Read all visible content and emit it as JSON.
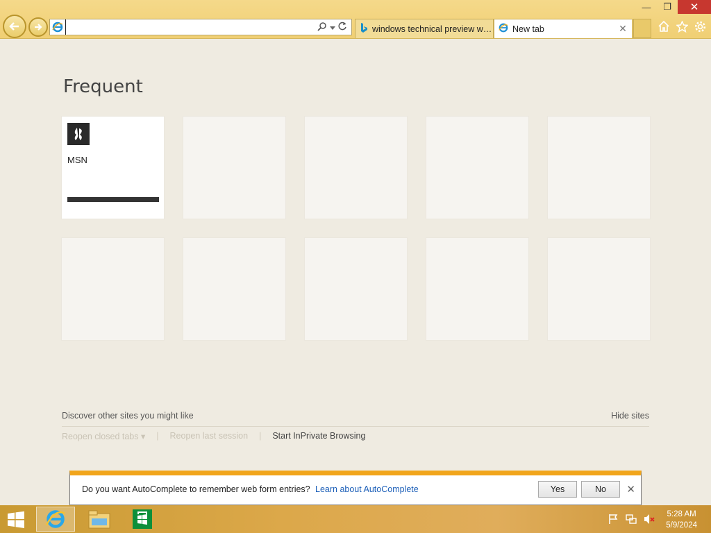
{
  "window": {
    "minimize_glyph": "—",
    "restore_glyph": "❐",
    "close_glyph": "✕"
  },
  "address_bar": {
    "value": "",
    "icon": "ie-icon"
  },
  "tabs": [
    {
      "title": "windows technical preview wal...",
      "icon": "bing-icon",
      "active": false
    },
    {
      "title": "New tab",
      "icon": "ie-icon",
      "active": true,
      "close_glyph": "✕"
    }
  ],
  "toolbar_icons": [
    "home-icon",
    "favorites-star-icon",
    "settings-gear-icon"
  ],
  "page": {
    "section_title": "Frequent",
    "tiles": [
      {
        "label": "MSN",
        "icon": "msn-butterfly-icon",
        "filled": true
      },
      {
        "label": "",
        "filled": false
      },
      {
        "label": "",
        "filled": false
      },
      {
        "label": "",
        "filled": false
      },
      {
        "label": "",
        "filled": false
      },
      {
        "label": "",
        "filled": false
      },
      {
        "label": "",
        "filled": false
      },
      {
        "label": "",
        "filled": false
      },
      {
        "label": "",
        "filled": false
      },
      {
        "label": "",
        "filled": false
      }
    ],
    "discover_text": "Discover other sites you might like",
    "hide_sites": "Hide sites",
    "reopen_closed_tabs": "Reopen closed tabs",
    "reopen_last_session": "Reopen last session",
    "start_inprivate": "Start InPrivate Browsing",
    "separator": "|",
    "dropdown_glyph": "▾"
  },
  "notification": {
    "message": "Do you want AutoComplete to remember web form entries?",
    "link": "Learn about AutoComplete",
    "yes": "Yes",
    "no": "No",
    "close_glyph": "✕"
  },
  "taskbar": {
    "items": [
      "internet-explorer-icon",
      "file-explorer-icon",
      "store-icon"
    ],
    "tray_icons": [
      "action-center-flag-icon",
      "network-icon",
      "volume-muted-icon"
    ],
    "time": "5:28 AM",
    "date": "5/9/2024"
  },
  "colors": {
    "chrome": "#f0cf74",
    "page_bg": "#efebe1",
    "notify_accent": "#f1a51b",
    "link": "#1c5fb8",
    "close_btn": "#c7372f"
  }
}
